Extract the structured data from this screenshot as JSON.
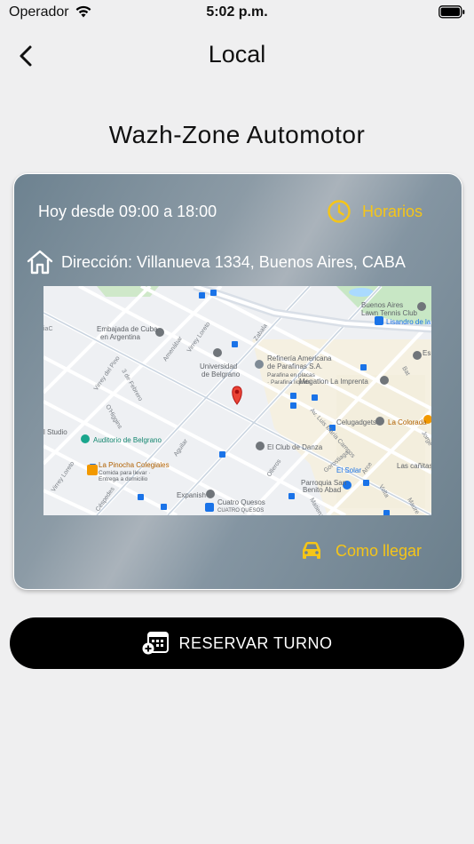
{
  "status_bar": {
    "carrier": "Operador",
    "time": "5:02 p.m."
  },
  "nav": {
    "title": "Local"
  },
  "business": {
    "name": "Wazh-Zone Automotor"
  },
  "card": {
    "hours": "Hoy desde 09:00 a 18:00",
    "schedule_label": "Horarios",
    "address": "Dirección: Villanueva 1334, Buenos Aires, CABA",
    "directions_label": "Como llegar"
  },
  "map": {
    "labels": {
      "buenos_aires_lawn": "Buenos Aires",
      "lawn_tennis": "Lawn Tennis Club",
      "lisandro": "Lisandro de la",
      "embajada": "Embajada de Cuba",
      "en_argentina": "en Argentina",
      "universidad": "Universidad",
      "de_belgrano": "de Belgrano",
      "refineria": "Refinería Americana",
      "de_parafinas": "de Parafinas S.A.",
      "parafina_placas": "Parafina en placas",
      "parafina_liquida": "· Parafina líquida",
      "megatlon": "Megatlon La Imprenta",
      "celugadgets": "Celugadgets",
      "la_colorada": "La Colorada",
      "el_club_danza": "El Club de Danza",
      "auditorio": "Auditorio de Belgrano",
      "pinocha": "La Pinocha Colegiales",
      "comida": "Comida para llevar ·",
      "entrega": "Entrega a domicilio",
      "expanish": "Expanish",
      "cuatro_quesos": "Cuatro Quesos",
      "cuatro_quesos_sub": "CUATRO QUESOS",
      "el_solar": "El Solar",
      "parroquia": "Parroquia San",
      "benito": "Benito Abad",
      "las_canitas": "Las cañitas",
      "studio": "l Studio",
      "es": "Es",
      "st_zabala": "Zabala",
      "st_virrey_loreto": "Virrey Loreto",
      "st_virrey_pino": "Virrey del Pino",
      "st_amenabar": "Amenábar",
      "st_av_luis": "Av. Luis María Campos",
      "st_gorostiaga": "Gorostiaga",
      "st_olleros": "Olleros",
      "st_aguilar": "Aguilar",
      "st_cespedes": "Céspedes",
      "st_virrey_loreto2": "Virrey Loreto",
      "st_3_febrero": "3 de Febrero",
      "st_o_higgins": "O'Higgins",
      "st_arce": "Arce",
      "st_volta": "Volta",
      "st_maure": "Maure",
      "st_matienzo": "Matienzo",
      "st_bat": "Bat",
      "st_jorge": "Jorge",
      "st_iaco": "iaC"
    }
  },
  "reserve_button": {
    "label": "RESERVAR TURNO"
  },
  "colors": {
    "accent": "#f5c518",
    "button_bg": "#000000",
    "background": "#efeff0"
  },
  "icons": {
    "back": "chevron-left-icon",
    "clock": "clock-icon",
    "home": "home-icon",
    "car": "car-icon",
    "calendar_add": "calendar-add-icon",
    "map_pin": "map-pin-icon"
  }
}
